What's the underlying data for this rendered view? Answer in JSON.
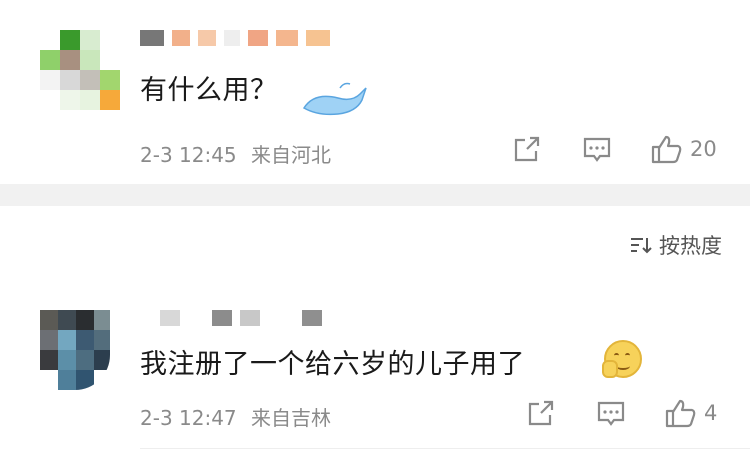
{
  "comments": [
    {
      "text": "有什么用？",
      "time": "2-3 12:45",
      "location": "来自河北",
      "likes": "20"
    },
    {
      "text": "我注册了一个给六岁的儿子用了",
      "time": "2-3 12:47",
      "location": "来自吉林",
      "likes": "4"
    }
  ],
  "sort": {
    "label": "按热度",
    "icon": "sort-icon"
  },
  "icons": {
    "share": "share-icon",
    "comment": "comment-icon",
    "like": "thumbs-up-icon"
  },
  "colors": {
    "meta": "#8a8a8a",
    "separator": "#f1f1f1",
    "text": "#1a1a1a"
  }
}
